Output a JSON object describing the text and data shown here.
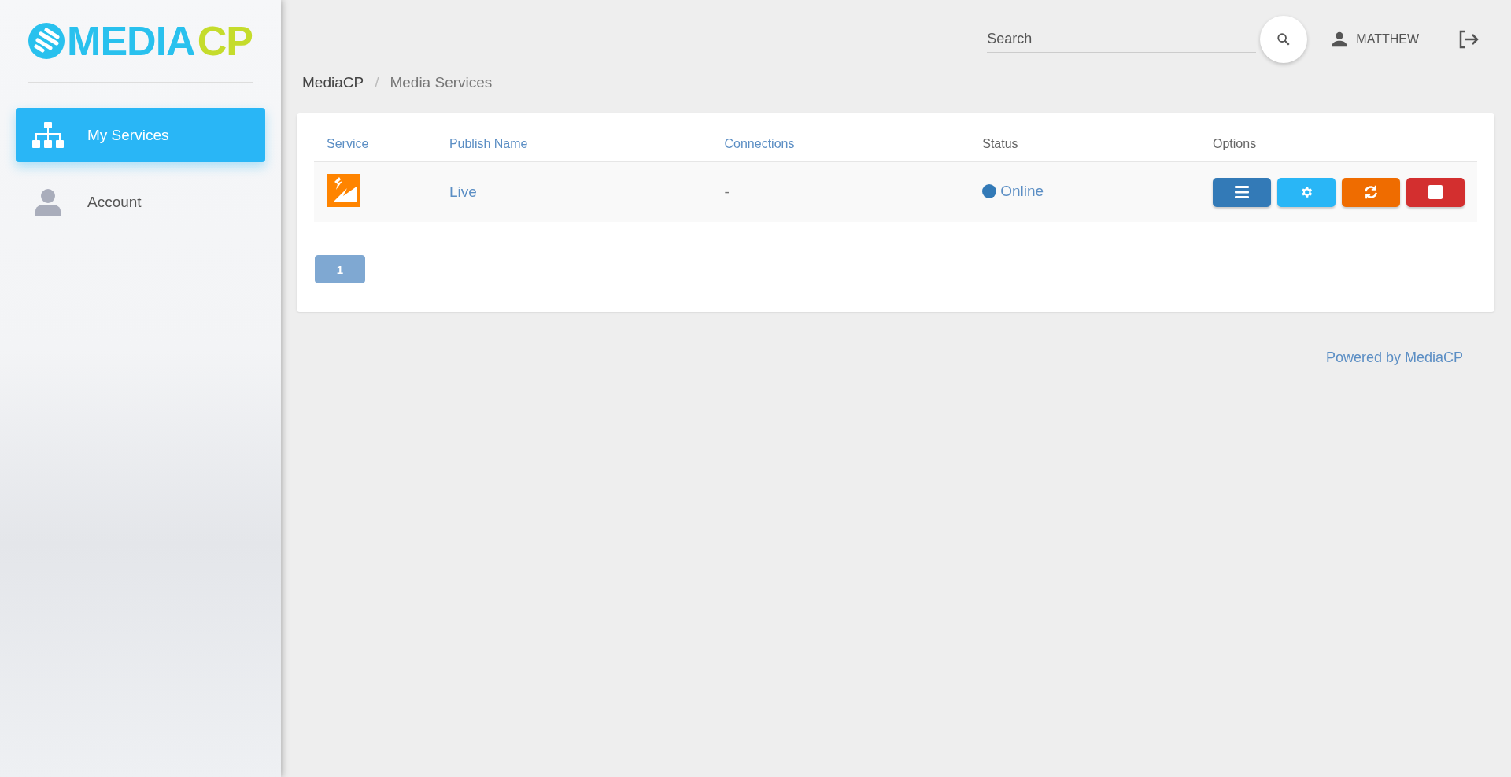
{
  "logo": {
    "text_main": "MEDIA",
    "text_accent": "CP"
  },
  "sidebar": {
    "items": [
      {
        "label": "My Services",
        "kind": "sitemap",
        "selected": true
      },
      {
        "label": "Account",
        "kind": "person",
        "selected": false
      }
    ]
  },
  "search": {
    "placeholder": "Search"
  },
  "user": {
    "name": "MATTHEW"
  },
  "breadcrumb": {
    "separator": "/",
    "items": [
      {
        "label": "MediaCP"
      },
      {
        "label": "Media Services"
      }
    ]
  },
  "table": {
    "columns": [
      "Service",
      "Publish Name",
      "Connections",
      "Status",
      "Options"
    ],
    "rows": [
      {
        "publish_name": "Live",
        "connections": "-",
        "status": {
          "label": "Online",
          "color": "#337ab7"
        },
        "options": [
          {
            "kind": "menu",
            "color": "#337ab7"
          },
          {
            "kind": "settings",
            "color": "#29b6f6"
          },
          {
            "kind": "restart",
            "color": "#ef6c00"
          },
          {
            "kind": "stop",
            "color": "#d32f2f"
          }
        ]
      }
    ]
  },
  "pagination": [
    {
      "label": "1",
      "selected": true
    }
  ],
  "footer": {
    "text": "Powered by MediaCP"
  }
}
